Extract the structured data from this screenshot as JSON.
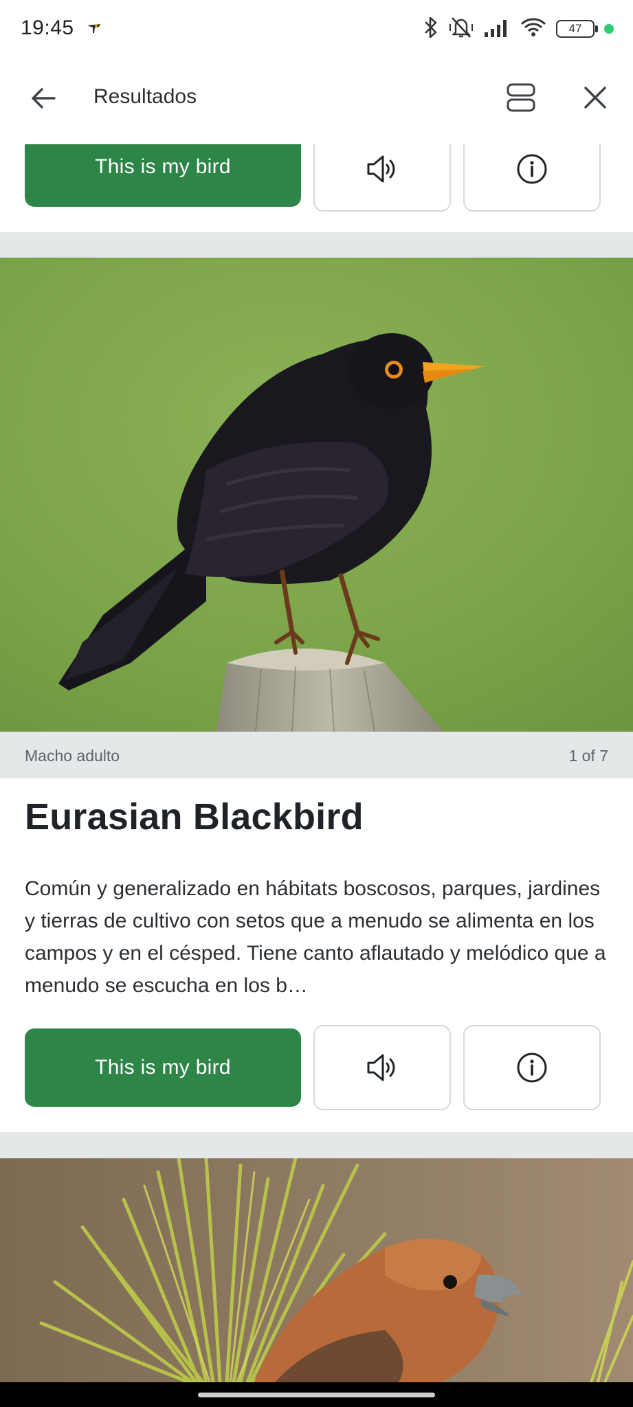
{
  "status_bar": {
    "time": "19:45",
    "battery_level": "47",
    "icons": [
      "app-bird-icon",
      "bluetooth-icon",
      "mute-vibrate-icon",
      "signal-icon",
      "wifi-icon",
      "battery-icon",
      "green-dot-indicator"
    ]
  },
  "app_bar": {
    "title": "Resultados",
    "icons": [
      "back-arrow-icon",
      "layout-toggle-icon",
      "close-icon"
    ]
  },
  "top_card": {
    "primary_button_label": "This is my bird",
    "icons": [
      "speaker-icon",
      "info-icon"
    ]
  },
  "main_card": {
    "photo_caption": "Macho adulto",
    "photo_counter": "1 of 7",
    "species_name": "Eurasian Blackbird",
    "description": "Común y generalizado en hábitats boscosos, parques, jardines y tierras de cultivo con setos que a menudo se alimenta en los campos y en el césped. Tiene canto aflautado y melódico que a menudo se escucha en los b…",
    "primary_button_label": "This is my bird",
    "icons": [
      "speaker-icon",
      "info-icon"
    ]
  },
  "colors": {
    "accent_green": "#2e8548",
    "divider_gray": "#e4e8e9"
  }
}
